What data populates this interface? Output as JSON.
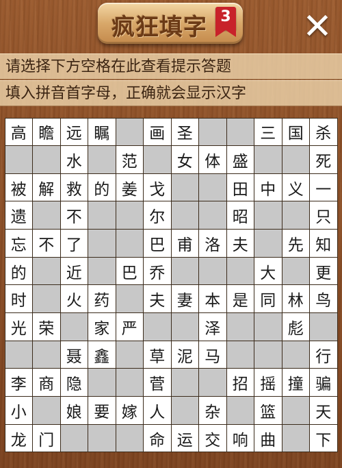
{
  "header": {
    "title": "疯狂填字",
    "level": "3",
    "close_symbol": "✕"
  },
  "hints": {
    "line1": "请选择下方空格在此查看提示答题",
    "line2": "填入拼音首字母，正确就会显示汉字"
  },
  "grid": {
    "rows": [
      [
        "高",
        "瞻",
        "远",
        "瞩",
        "",
        "画",
        "圣",
        "",
        "",
        "三",
        "国",
        "杀"
      ],
      [
        "",
        "",
        "水",
        "",
        "范",
        "",
        "女",
        "体",
        "盛",
        "",
        "",
        "死"
      ],
      [
        "被",
        "解",
        "救",
        "的",
        "姜",
        "戈",
        "",
        "",
        "田",
        "中",
        "义",
        "一"
      ],
      [
        "遗",
        "",
        "不",
        "",
        "",
        "尔",
        "",
        "",
        "昭",
        "",
        "",
        "只"
      ],
      [
        "忘",
        "不",
        "了",
        "",
        "",
        "巴",
        "甫",
        "洛",
        "夫",
        "",
        "先",
        "知"
      ],
      [
        "的",
        "",
        "近",
        "",
        "巴",
        "乔",
        "",
        "",
        "",
        "大",
        "",
        "更"
      ],
      [
        "时",
        "",
        "火",
        "药",
        "",
        "夫",
        "妻",
        "本",
        "是",
        "同",
        "林",
        "鸟"
      ],
      [
        "光",
        "荣",
        "",
        "家",
        "严",
        "",
        "",
        "泽",
        "",
        "",
        "彪",
        ""
      ],
      [
        "",
        "",
        "聂",
        "鑫",
        "",
        "草",
        "泥",
        "马",
        "",
        "",
        "",
        "行"
      ],
      [
        "李",
        "商",
        "隐",
        "",
        "",
        "菅",
        "",
        "",
        "招",
        "摇",
        "撞",
        "骗"
      ],
      [
        "小",
        "",
        "娘",
        "要",
        "嫁",
        "人",
        "",
        "杂",
        "",
        "篮",
        "",
        "天"
      ],
      [
        "龙",
        "门",
        "",
        "",
        "",
        "命",
        "运",
        "交",
        "响",
        "曲",
        "",
        "下"
      ]
    ]
  }
}
